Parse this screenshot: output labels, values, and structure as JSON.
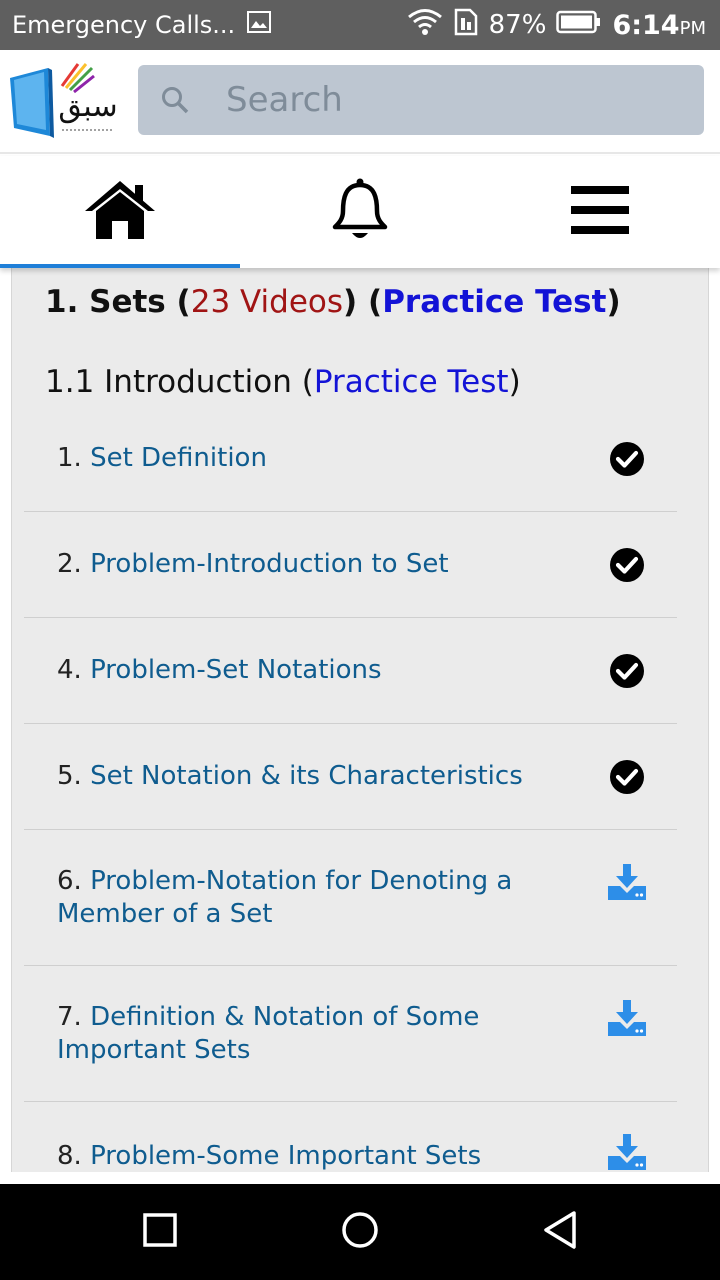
{
  "status_bar": {
    "notification": "Emergency Calls...",
    "battery": "87%",
    "time": "6:14",
    "ampm": "PM"
  },
  "header": {
    "logo_text": "سبق",
    "search_placeholder": "Search"
  },
  "tabs": [
    {
      "name": "home",
      "icon": "home-icon",
      "active": true
    },
    {
      "name": "notifications",
      "icon": "bell-icon",
      "active": false
    },
    {
      "name": "menu",
      "icon": "menu-icon",
      "active": false
    }
  ],
  "colors": {
    "accent": "#1f7fd8",
    "link_blue": "#1313d6",
    "item_link": "#0f5c8f",
    "videos_red": "#a01414",
    "download_blue": "#2d8ee8"
  },
  "chapter": {
    "number": "1. Sets",
    "videos": "23 Videos",
    "practice_test": "Practice Test"
  },
  "section": {
    "title": "1.1 Introduction",
    "practice_test": "Practice Test"
  },
  "items": [
    {
      "num": "1.",
      "title": "Set Definition",
      "status": "completed"
    },
    {
      "num": "2.",
      "title": "Problem-Introduction to Set",
      "status": "completed"
    },
    {
      "num": "4.",
      "title": "Problem-Set Notations",
      "status": "completed"
    },
    {
      "num": "5.",
      "title": "Set Notation & its Characteristics",
      "status": "completed"
    },
    {
      "num": "6.",
      "title": "Problem-Notation for Denoting a Member of a Set",
      "status": "download"
    },
    {
      "num": "7.",
      "title": "Definition & Notation of Some Important Sets",
      "status": "download"
    },
    {
      "num": "8.",
      "title": "Problem-Some Important Sets",
      "status": "download"
    }
  ]
}
